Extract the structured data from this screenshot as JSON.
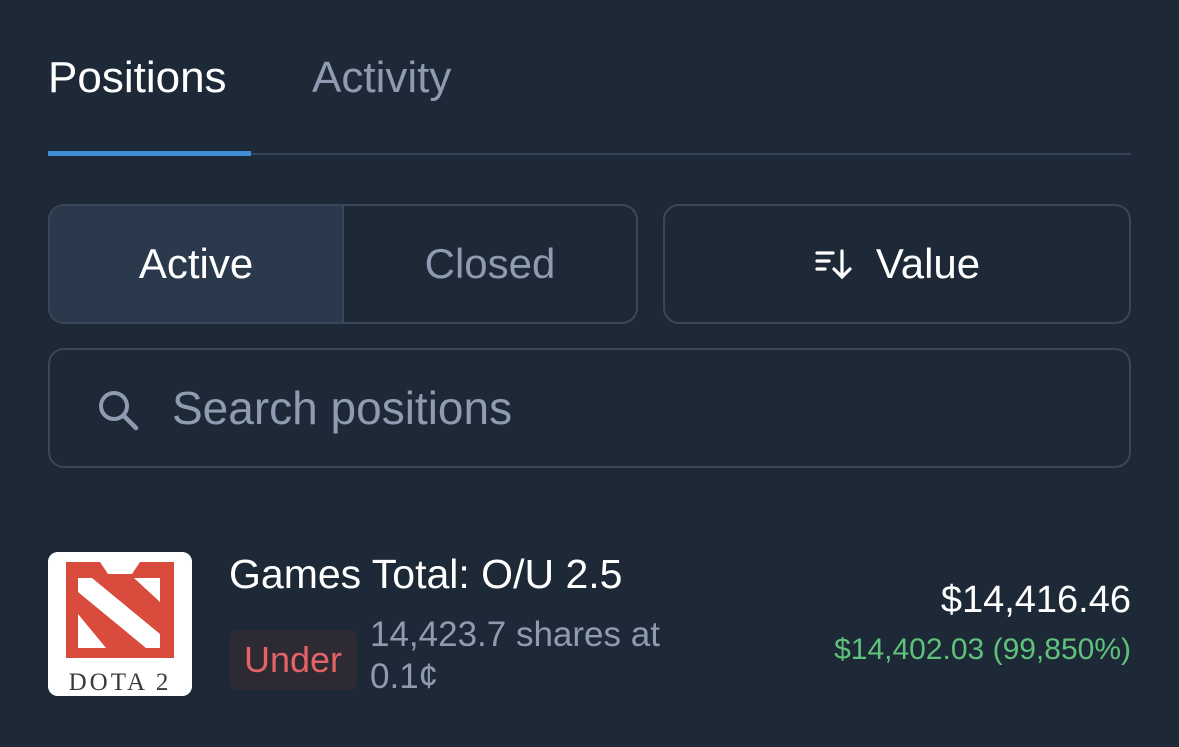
{
  "tabs": [
    {
      "label": "Positions",
      "selected": true
    },
    {
      "label": "Activity",
      "selected": false
    }
  ],
  "filter": {
    "active_label": "Active",
    "closed_label": "Closed",
    "selected": "Active"
  },
  "sort": {
    "label": "Value",
    "icon": "sort-descending-icon"
  },
  "search": {
    "placeholder": "Search positions",
    "value": "",
    "icon": "search-icon"
  },
  "positions": [
    {
      "icon": "dota2-logo",
      "icon_caption": "DOTA 2",
      "title": "Games Total: O/U 2.5",
      "outcome": "Under",
      "shares_text": "14,423.7 shares at 0.1¢",
      "value": "$14,416.46",
      "pnl": "$14,402.03 (99,850%)"
    }
  ],
  "colors": {
    "background": "#1e2938",
    "accent": "#3f8fd8",
    "border": "#394759",
    "muted_text": "#8e9bb0",
    "under_red": "#e36463",
    "profit_green": "#5fc27a",
    "dota_red": "#d94c3d"
  }
}
